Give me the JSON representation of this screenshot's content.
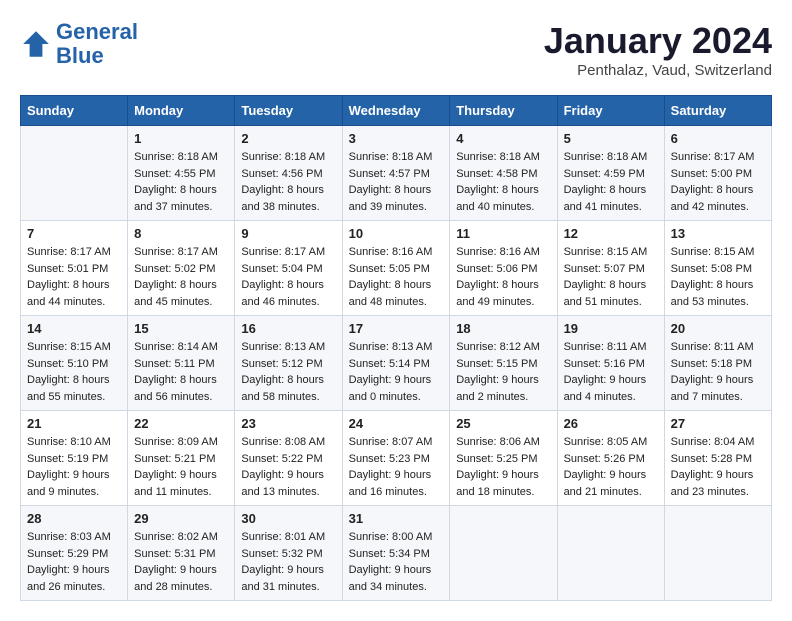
{
  "header": {
    "logo_line1": "General",
    "logo_line2": "Blue",
    "month_title": "January 2024",
    "location": "Penthalaz, Vaud, Switzerland"
  },
  "days_of_week": [
    "Sunday",
    "Monday",
    "Tuesday",
    "Wednesday",
    "Thursday",
    "Friday",
    "Saturday"
  ],
  "weeks": [
    [
      {
        "day": "",
        "info": ""
      },
      {
        "day": "1",
        "info": "Sunrise: 8:18 AM\nSunset: 4:55 PM\nDaylight: 8 hours\nand 37 minutes."
      },
      {
        "day": "2",
        "info": "Sunrise: 8:18 AM\nSunset: 4:56 PM\nDaylight: 8 hours\nand 38 minutes."
      },
      {
        "day": "3",
        "info": "Sunrise: 8:18 AM\nSunset: 4:57 PM\nDaylight: 8 hours\nand 39 minutes."
      },
      {
        "day": "4",
        "info": "Sunrise: 8:18 AM\nSunset: 4:58 PM\nDaylight: 8 hours\nand 40 minutes."
      },
      {
        "day": "5",
        "info": "Sunrise: 8:18 AM\nSunset: 4:59 PM\nDaylight: 8 hours\nand 41 minutes."
      },
      {
        "day": "6",
        "info": "Sunrise: 8:17 AM\nSunset: 5:00 PM\nDaylight: 8 hours\nand 42 minutes."
      }
    ],
    [
      {
        "day": "7",
        "info": "Sunrise: 8:17 AM\nSunset: 5:01 PM\nDaylight: 8 hours\nand 44 minutes."
      },
      {
        "day": "8",
        "info": "Sunrise: 8:17 AM\nSunset: 5:02 PM\nDaylight: 8 hours\nand 45 minutes."
      },
      {
        "day": "9",
        "info": "Sunrise: 8:17 AM\nSunset: 5:04 PM\nDaylight: 8 hours\nand 46 minutes."
      },
      {
        "day": "10",
        "info": "Sunrise: 8:16 AM\nSunset: 5:05 PM\nDaylight: 8 hours\nand 48 minutes."
      },
      {
        "day": "11",
        "info": "Sunrise: 8:16 AM\nSunset: 5:06 PM\nDaylight: 8 hours\nand 49 minutes."
      },
      {
        "day": "12",
        "info": "Sunrise: 8:15 AM\nSunset: 5:07 PM\nDaylight: 8 hours\nand 51 minutes."
      },
      {
        "day": "13",
        "info": "Sunrise: 8:15 AM\nSunset: 5:08 PM\nDaylight: 8 hours\nand 53 minutes."
      }
    ],
    [
      {
        "day": "14",
        "info": "Sunrise: 8:15 AM\nSunset: 5:10 PM\nDaylight: 8 hours\nand 55 minutes."
      },
      {
        "day": "15",
        "info": "Sunrise: 8:14 AM\nSunset: 5:11 PM\nDaylight: 8 hours\nand 56 minutes."
      },
      {
        "day": "16",
        "info": "Sunrise: 8:13 AM\nSunset: 5:12 PM\nDaylight: 8 hours\nand 58 minutes."
      },
      {
        "day": "17",
        "info": "Sunrise: 8:13 AM\nSunset: 5:14 PM\nDaylight: 9 hours\nand 0 minutes."
      },
      {
        "day": "18",
        "info": "Sunrise: 8:12 AM\nSunset: 5:15 PM\nDaylight: 9 hours\nand 2 minutes."
      },
      {
        "day": "19",
        "info": "Sunrise: 8:11 AM\nSunset: 5:16 PM\nDaylight: 9 hours\nand 4 minutes."
      },
      {
        "day": "20",
        "info": "Sunrise: 8:11 AM\nSunset: 5:18 PM\nDaylight: 9 hours\nand 7 minutes."
      }
    ],
    [
      {
        "day": "21",
        "info": "Sunrise: 8:10 AM\nSunset: 5:19 PM\nDaylight: 9 hours\nand 9 minutes."
      },
      {
        "day": "22",
        "info": "Sunrise: 8:09 AM\nSunset: 5:21 PM\nDaylight: 9 hours\nand 11 minutes."
      },
      {
        "day": "23",
        "info": "Sunrise: 8:08 AM\nSunset: 5:22 PM\nDaylight: 9 hours\nand 13 minutes."
      },
      {
        "day": "24",
        "info": "Sunrise: 8:07 AM\nSunset: 5:23 PM\nDaylight: 9 hours\nand 16 minutes."
      },
      {
        "day": "25",
        "info": "Sunrise: 8:06 AM\nSunset: 5:25 PM\nDaylight: 9 hours\nand 18 minutes."
      },
      {
        "day": "26",
        "info": "Sunrise: 8:05 AM\nSunset: 5:26 PM\nDaylight: 9 hours\nand 21 minutes."
      },
      {
        "day": "27",
        "info": "Sunrise: 8:04 AM\nSunset: 5:28 PM\nDaylight: 9 hours\nand 23 minutes."
      }
    ],
    [
      {
        "day": "28",
        "info": "Sunrise: 8:03 AM\nSunset: 5:29 PM\nDaylight: 9 hours\nand 26 minutes."
      },
      {
        "day": "29",
        "info": "Sunrise: 8:02 AM\nSunset: 5:31 PM\nDaylight: 9 hours\nand 28 minutes."
      },
      {
        "day": "30",
        "info": "Sunrise: 8:01 AM\nSunset: 5:32 PM\nDaylight: 9 hours\nand 31 minutes."
      },
      {
        "day": "31",
        "info": "Sunrise: 8:00 AM\nSunset: 5:34 PM\nDaylight: 9 hours\nand 34 minutes."
      },
      {
        "day": "",
        "info": ""
      },
      {
        "day": "",
        "info": ""
      },
      {
        "day": "",
        "info": ""
      }
    ]
  ]
}
